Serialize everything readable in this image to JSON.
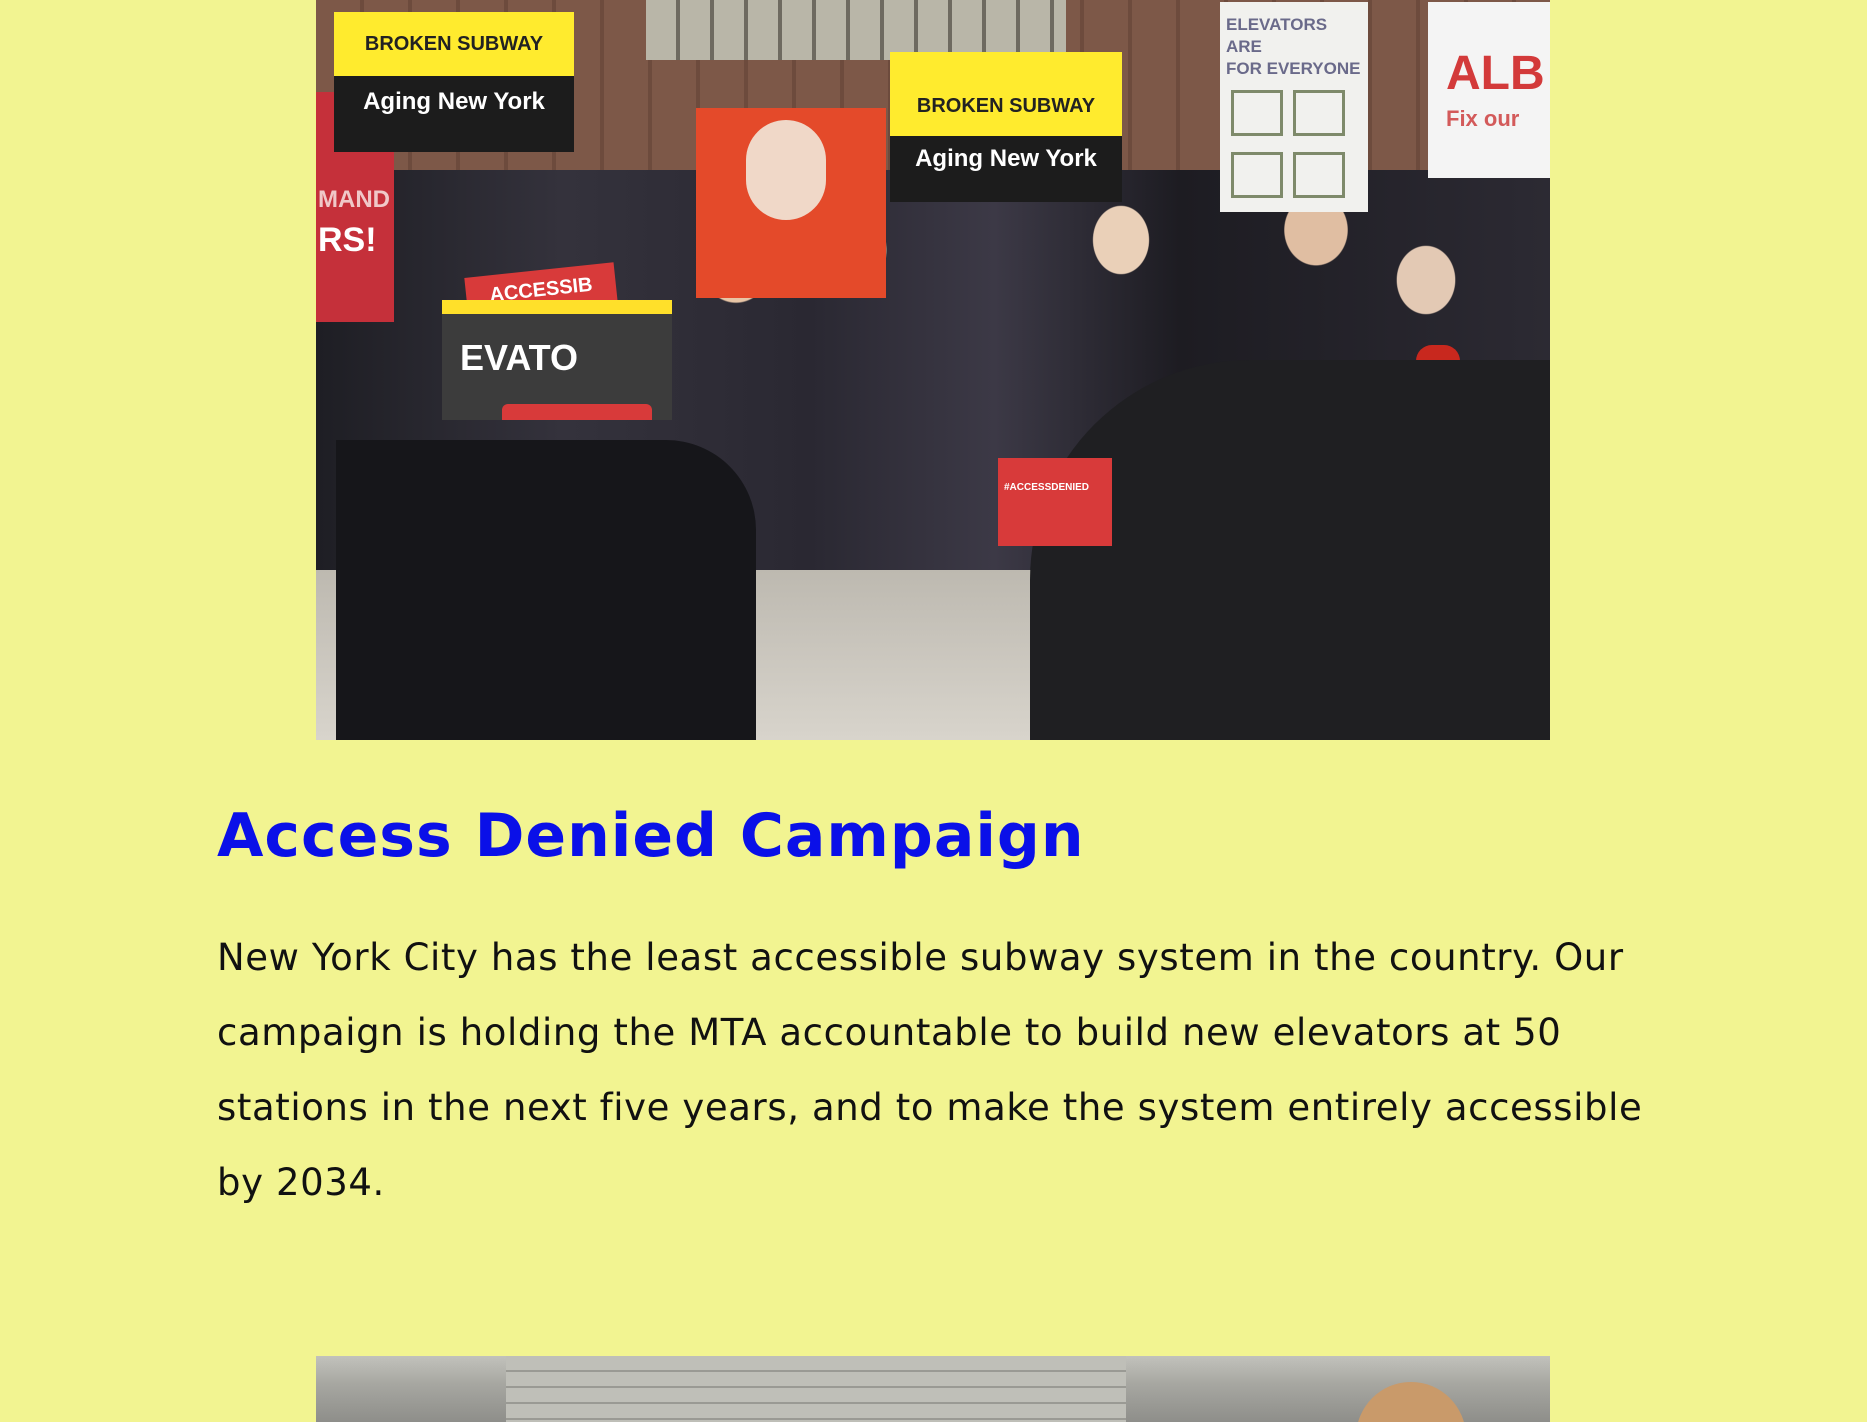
{
  "photo_main": {
    "alt": "Rally photo with protesters holding signs",
    "signs": {
      "broken_1_top": "BROKEN SUBWAY",
      "broken_1_bottom": "Aging New York",
      "broken_2_top": "BROKEN SUBWAY",
      "broken_2_bottom": "Aging New York",
      "elevators_line1": "ELEVATORS ARE",
      "elevators_line2": "FOR EVERYONE",
      "alb_big": "ALB",
      "alb_small": "Fix our",
      "red_left_top": "MAND",
      "red_left_big": "RS!",
      "accessible": "ACCESSIB",
      "elevator": "EVATO",
      "podium": "#ACCESSDENIED"
    }
  },
  "section": {
    "title": "Access Denied Campaign",
    "body": "New York City has the least accessible subway system in the country. Our campaign is holding the MTA accountable to build new elevators at 50 stations in the next five years, and to make the system entirely accessible by 2034."
  },
  "colors": {
    "page_background": "#f2f491",
    "heading": "#0a10e8",
    "body_text": "#111111"
  }
}
